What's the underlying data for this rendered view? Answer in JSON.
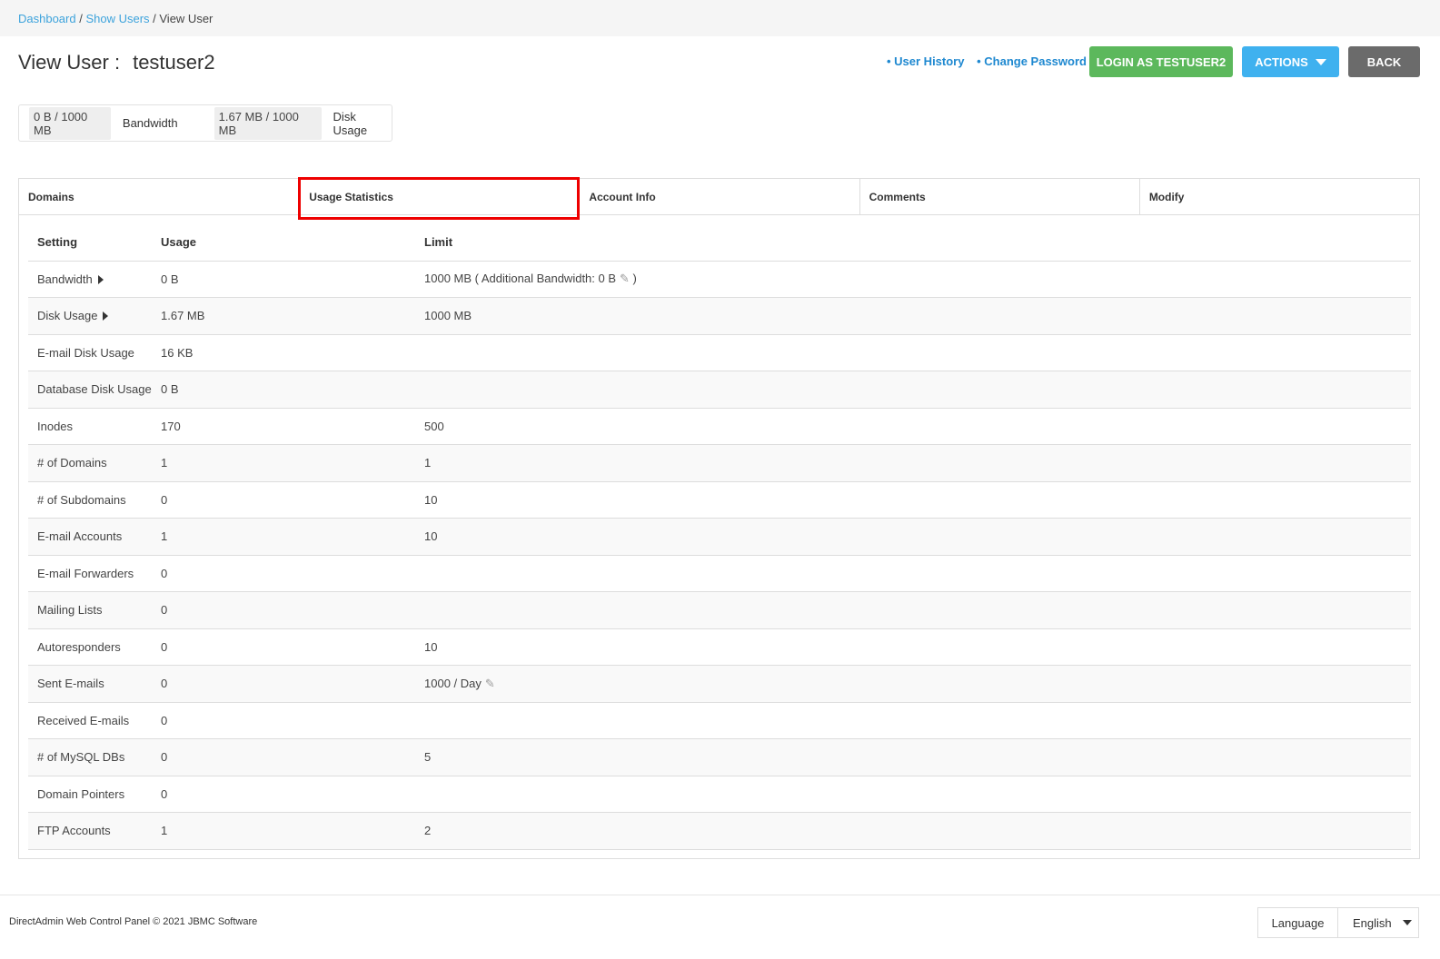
{
  "breadcrumb": {
    "dashboard": "Dashboard",
    "sep1": " / ",
    "show_users": "Show Users",
    "sep2": " / ",
    "current": "View User"
  },
  "header": {
    "title_prefix": "View User :",
    "username": "testuser2",
    "links": [
      "• User History",
      "• Change Password"
    ],
    "login_button": "LOGIN AS TESTUSER2",
    "actions_button": "ACTIONS",
    "back_button": "BACK",
    "colors": {
      "login": "#5cb85c",
      "actions": "#3fb1ef",
      "back": "#6b6b6b",
      "link": "#1e88d0"
    }
  },
  "summary": {
    "bandwidth_value": "0 B / 1000 MB",
    "bandwidth_label": "Bandwidth",
    "disk_value": "1.67 MB / 1000 MB",
    "disk_label": "Disk Usage"
  },
  "tabs": [
    "Domains",
    "Usage Statistics",
    "Account Info",
    "Comments",
    "Modify"
  ],
  "highlight_color": "#ee0000",
  "table": {
    "headers": [
      "Setting",
      "Usage",
      "Limit"
    ],
    "rows": [
      {
        "setting": "Bandwidth",
        "usage": "0 B",
        "limit": "1000 MB ( Additional Bandwidth: 0 B",
        "limit_suffix": " )",
        "expand": true,
        "edit": true
      },
      {
        "setting": "Disk Usage",
        "usage": "1.67 MB",
        "limit": "1000 MB",
        "limit_suffix": "",
        "expand": true,
        "edit": false
      },
      {
        "setting": "E-mail Disk Usage",
        "usage": "16 KB",
        "limit": "",
        "limit_suffix": "",
        "expand": false,
        "edit": false
      },
      {
        "setting": "Database Disk Usage",
        "usage": "0 B",
        "limit": "",
        "limit_suffix": "",
        "expand": false,
        "edit": false
      },
      {
        "setting": "Inodes",
        "usage": "170",
        "limit": "500",
        "limit_suffix": "",
        "expand": false,
        "edit": false
      },
      {
        "setting": "# of Domains",
        "usage": "1",
        "limit": "1",
        "limit_suffix": "",
        "expand": false,
        "edit": false
      },
      {
        "setting": "# of Subdomains",
        "usage": "0",
        "limit": "10",
        "limit_suffix": "",
        "expand": false,
        "edit": false
      },
      {
        "setting": "E-mail Accounts",
        "usage": "1",
        "limit": "10",
        "limit_suffix": "",
        "expand": false,
        "edit": false
      },
      {
        "setting": "E-mail Forwarders",
        "usage": "0",
        "limit": "",
        "limit_suffix": "",
        "expand": false,
        "edit": false
      },
      {
        "setting": "Mailing Lists",
        "usage": "0",
        "limit": "",
        "limit_suffix": "",
        "expand": false,
        "edit": false
      },
      {
        "setting": "Autoresponders",
        "usage": "0",
        "limit": "10",
        "limit_suffix": "",
        "expand": false,
        "edit": false
      },
      {
        "setting": "Sent E-mails",
        "usage": "0",
        "limit": "1000 / Day",
        "limit_suffix": "",
        "expand": false,
        "edit": true
      },
      {
        "setting": "Received E-mails",
        "usage": "0",
        "limit": "",
        "limit_suffix": "",
        "expand": false,
        "edit": false
      },
      {
        "setting": "# of MySQL DBs",
        "usage": "0",
        "limit": "5",
        "limit_suffix": "",
        "expand": false,
        "edit": false
      },
      {
        "setting": "Domain Pointers",
        "usage": "0",
        "limit": "",
        "limit_suffix": "",
        "expand": false,
        "edit": false
      },
      {
        "setting": "FTP Accounts",
        "usage": "1",
        "limit": "2",
        "limit_suffix": "",
        "expand": false,
        "edit": false
      }
    ]
  },
  "footer": {
    "copyright": "DirectAdmin Web Control Panel © 2021 JBMC Software",
    "language_label": "Language",
    "language_value": "English"
  }
}
